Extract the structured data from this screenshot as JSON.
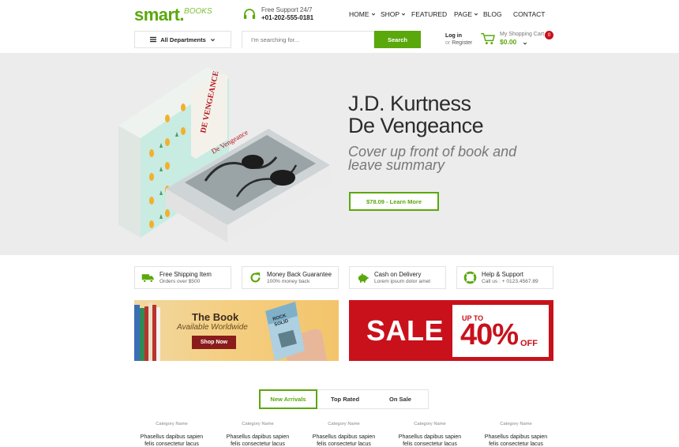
{
  "brand": {
    "logo_main": "smart",
    "logo_dot": ".",
    "logo_sub": "BOOKS"
  },
  "support": {
    "label": "Free Support 24/7",
    "phone": "+01-202-555-0181"
  },
  "nav": [
    {
      "label": "HOME",
      "has_dropdown": true
    },
    {
      "label": "SHOP",
      "has_dropdown": true
    },
    {
      "label": "FEATURED",
      "has_dropdown": false
    },
    {
      "label": "PAGE",
      "has_dropdown": true
    },
    {
      "label": "BLOG",
      "has_dropdown": false
    },
    {
      "label": "CONTACT",
      "has_dropdown": false
    }
  ],
  "departments": {
    "label": "All Departments"
  },
  "search": {
    "placeholder": "I'm searching for...",
    "button": "Search"
  },
  "account": {
    "login": "Log in",
    "or": "or",
    "register": "Register"
  },
  "cart": {
    "label": "My Shopping Cart",
    "total": "$0.00",
    "count": "0"
  },
  "hero": {
    "title_line1": "J.D. Kurtness",
    "title_line2": "De Vengeance",
    "subtitle_line1": "Cover up front of book and",
    "subtitle_line2": "leave summary",
    "cta": "$78.09 - Learn More"
  },
  "features": [
    {
      "title": "Free Shipping Item",
      "subtitle": "Orders over $500",
      "icon": "truck-icon"
    },
    {
      "title": "Money Back Guarantee",
      "subtitle": "100% money back",
      "icon": "refresh-icon"
    },
    {
      "title": "Cash on Delivery",
      "subtitle": "Lorem ipsum dolor amet",
      "icon": "piggy-bank-icon"
    },
    {
      "title": "Help & Support",
      "subtitle": "Call us : + 0123.4567.89",
      "icon": "lifebuoy-icon"
    }
  ],
  "banner_book": {
    "title": "The Book",
    "subtitle": "Available Worldwide",
    "button": "Shop Now",
    "book_title_line1": "ROCK",
    "book_title_line2": "SOLID"
  },
  "banner_sale": {
    "sale": "SALE",
    "up_to": "UP TO",
    "percent": "40%",
    "off": "OFF"
  },
  "tabs": [
    {
      "label": "New Arrivals",
      "active": true
    },
    {
      "label": "Top Rated",
      "active": false
    },
    {
      "label": "On Sale",
      "active": false
    }
  ],
  "products": [
    {
      "category": "Category Name",
      "name_line1": "Phasellus dapibus sapien",
      "name_line2": "felis consectetur lacus"
    },
    {
      "category": "Category Name",
      "name_line1": "Phasellus dapibus sapien",
      "name_line2": "felis consectetur lacus"
    },
    {
      "category": "Category Name",
      "name_line1": "Phasellus dapibus sapien",
      "name_line2": "felis consectetur lacus"
    },
    {
      "category": "Category Name",
      "name_line1": "Phasellus dapibus sapien",
      "name_line2": "felis consectetur lacus"
    },
    {
      "category": "Category Name",
      "name_line1": "Phasellus dapibus sapien",
      "name_line2": "felis consectetur lacus"
    }
  ],
  "colors": {
    "brand_green": "#5aa80c",
    "sale_red": "#c9111c",
    "hero_bg": "#ececec"
  }
}
